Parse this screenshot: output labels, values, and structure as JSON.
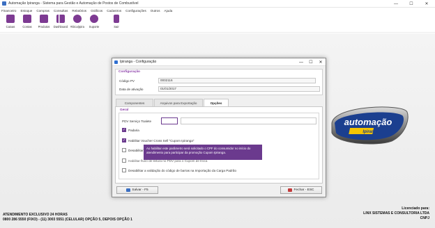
{
  "window": {
    "title": "Automação Ipiranga - Sistema para Gestão e Automação de Postos de Combustível",
    "minimize": "—",
    "maximize": "☐",
    "close": "✕"
  },
  "menu": [
    "Financeiro",
    "Estoque",
    "Compras",
    "Consultas",
    "Relatórios",
    "Gráficos",
    "Cadastros",
    "Configurações",
    "Outros",
    "Ajuda"
  ],
  "toolbar": [
    {
      "label": "Caixas",
      "icon": "cash-register-icon",
      "color": "#7d3a92"
    },
    {
      "label": "Contas",
      "icon": "accounts-icon",
      "color": "#7d3a92"
    },
    {
      "label": "Produtos",
      "icon": "products-icon",
      "color": "#7d3a92"
    },
    {
      "label": "Dashboard",
      "icon": "dashboard-icon",
      "color": "#7d3a92"
    },
    {
      "label": "#Dica|Ipira",
      "icon": "play-icon",
      "color": "#7d3a92"
    },
    {
      "label": "Suporte",
      "icon": "support-icon",
      "color": "#7d3a92"
    },
    {
      "label": "Sair",
      "icon": "exit-icon",
      "color": "#7d3a92"
    }
  ],
  "dialog": {
    "title": "Ipiranga - Configuração",
    "config_group": {
      "title": "Configuração",
      "codigo_pv_label": "Código PV",
      "codigo_pv_value": "0002116",
      "data_ativacao_label": "Data de ativação",
      "data_ativacao_value": "01/01/2017"
    },
    "tabs": [
      {
        "label": "Componentes",
        "active": false
      },
      {
        "label": "Arquivos para Exportação",
        "active": false
      },
      {
        "label": "Opções",
        "active": true
      }
    ],
    "geral": {
      "title": "Geral",
      "pdv_label": "PDV Serviço Toalete",
      "pdv_value": "",
      "padaria_label": "Padaria",
      "voucher_label": "Habilitar Voucher Cross Sell \"Cupom Ipiranga\"",
      "option3_label": "Desabilitar",
      "option4_label": "Habilitar fluxo de leitura no PDV para o Cupom de troca",
      "codigo_barras_label": "Desabilitar a validação do código de barras na Importação da Carga Padrão"
    },
    "tooltip": "Ao habilitar este parâmetro será solicitado o CPF do consumidor no início do atendimento para participar da promoção Cupom Ipiranga.",
    "save_label": "Salvar - F5",
    "close_label": "Fechar - ESC"
  },
  "logo": {
    "text": "automação",
    "brand": "Ipiranga",
    "accent": "#1b3f8f"
  },
  "footer": {
    "left_line1": "ATENDIMENTO EXCLUSIVO 24 HORAS",
    "left_line2": "0800 286 5550 (FIXO) - (11) 3003 5551 (CELULAR) OPÇÃO 5, DEPOIS OPÇÃO 1",
    "right_line1": "Licenciado para:",
    "right_line2": "LINX SISTEMAS E CONSULTORIA LTDA",
    "right_line3": "CNPJ"
  }
}
